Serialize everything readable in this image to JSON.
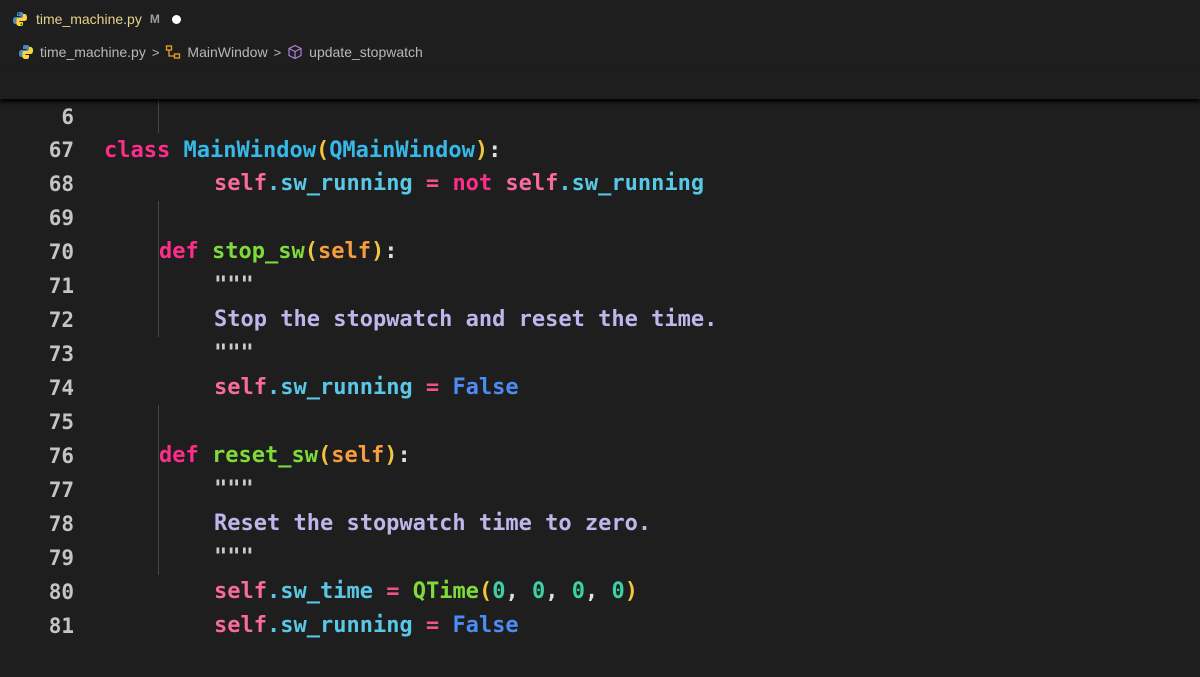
{
  "tab": {
    "label": "time_machine.py",
    "status": "M",
    "icon": "python-icon"
  },
  "breadcrumb": {
    "file": "time_machine.py",
    "class": "MainWindow",
    "method": "update_stopwatch"
  },
  "sticky": {
    "line_number": "6",
    "kw": "class",
    "name": "MainWindow",
    "open": "(",
    "base": "QMainWindow",
    "close": ")",
    "colon": ":"
  },
  "lines": [
    {
      "n": "67",
      "tokens": [
        "self",
        ".sw_running",
        " = ",
        "not",
        " self",
        ".sw_running"
      ]
    },
    {
      "n": "68",
      "tokens": []
    },
    {
      "n": "69",
      "tokens": [
        "def",
        " stop_sw",
        "(",
        "self",
        ")",
        ":"
      ]
    },
    {
      "n": "70",
      "tokens": [
        "\"\"\""
      ]
    },
    {
      "n": "71",
      "tokens": [
        "Stop the stopwatch and reset the time."
      ]
    },
    {
      "n": "72",
      "tokens": [
        "\"\"\""
      ]
    },
    {
      "n": "73",
      "tokens": [
        "self",
        ".sw_running",
        " = ",
        "False"
      ]
    },
    {
      "n": "74",
      "tokens": []
    },
    {
      "n": "75",
      "tokens": [
        "def",
        " reset_sw",
        "(",
        "self",
        ")",
        ":"
      ]
    },
    {
      "n": "76",
      "tokens": [
        "\"\"\""
      ]
    },
    {
      "n": "77",
      "tokens": [
        "Reset the stopwatch time to zero."
      ]
    },
    {
      "n": "78",
      "tokens": [
        "\"\"\""
      ]
    },
    {
      "n": "79",
      "tokens": [
        "self",
        ".sw_time",
        " = ",
        "QTime",
        "(",
        "0",
        ", ",
        "0",
        ", ",
        "0",
        ", ",
        "0",
        ")"
      ]
    },
    {
      "n": "80",
      "tokens": [
        "self",
        ".sw_running",
        " = ",
        "False"
      ]
    },
    {
      "n": "81",
      "tokens": []
    }
  ],
  "colors": {
    "keyword": "#ff2d8a",
    "class_name": "#36b8e8",
    "function": "#7fdb3a",
    "self": "#f96a9f",
    "boolean": "#4c8cf5",
    "number": "#3cd0a6",
    "docstring": "#c0b6ec",
    "modified_gutter": "#5f9e3a"
  }
}
